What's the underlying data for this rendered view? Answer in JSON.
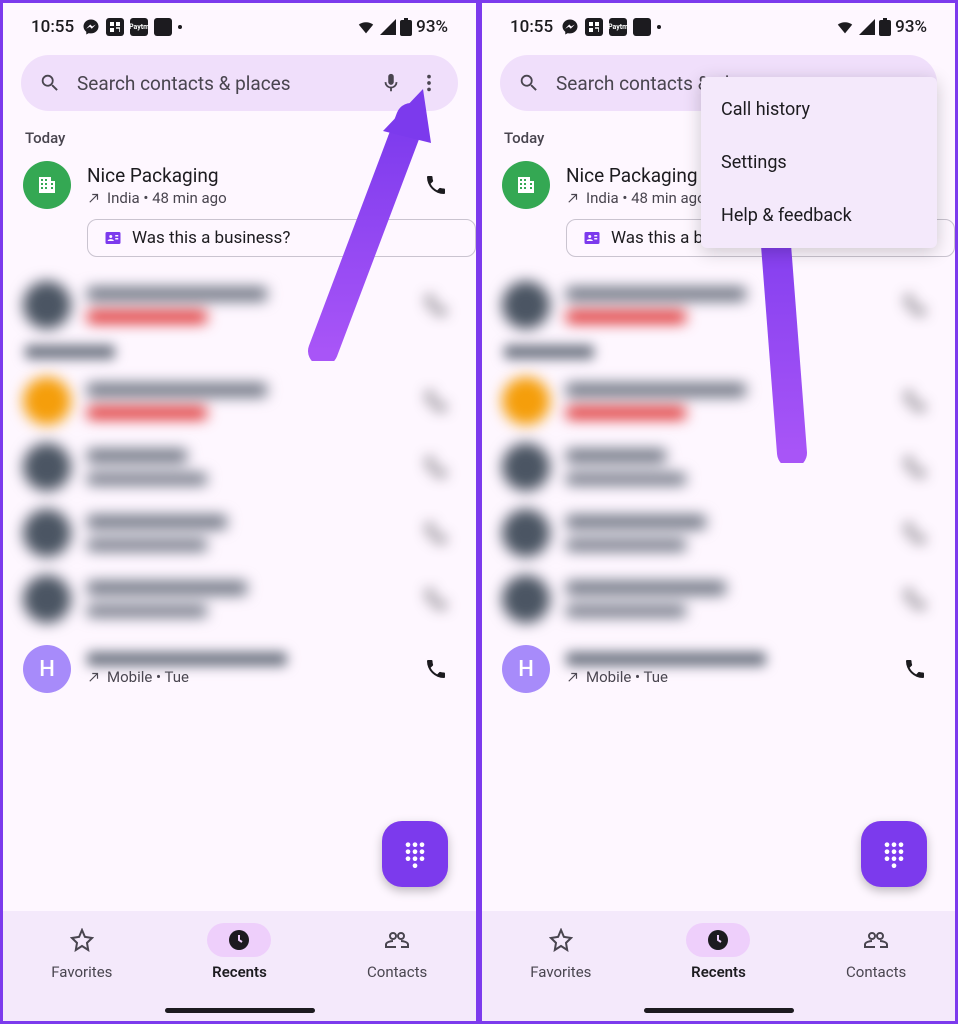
{
  "status": {
    "time": "10:55",
    "battery": "93%"
  },
  "search": {
    "placeholder": "Search contacts & places"
  },
  "section": {
    "today": "Today"
  },
  "call1": {
    "name": "Nice Packaging",
    "sub": "India • 48 min ago",
    "chip": "Was this a business?"
  },
  "blurred_last": {
    "avatar_letter": "H",
    "sub": "Mobile • Tue"
  },
  "nav": {
    "favorites": "Favorites",
    "recents": "Recents",
    "contacts": "Contacts"
  },
  "menu": {
    "call_history": "Call history",
    "settings": "Settings",
    "help": "Help & feedback"
  }
}
